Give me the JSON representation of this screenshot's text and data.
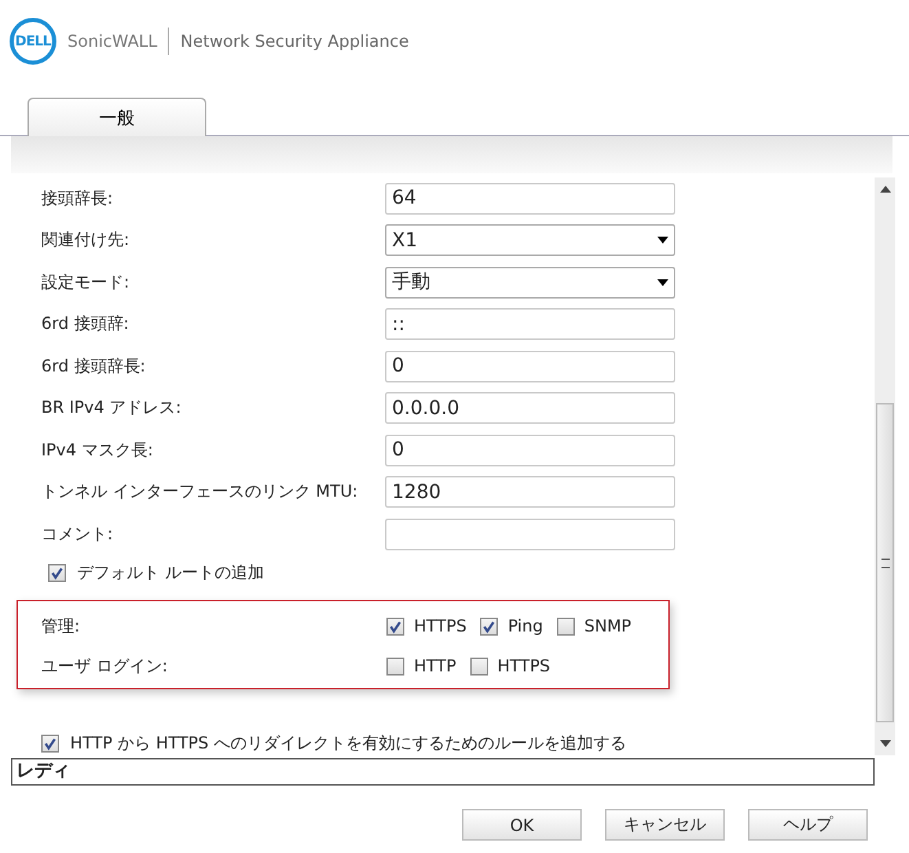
{
  "header": {
    "logo": "DELL",
    "product": "SonicWALL",
    "title": "Network Security Appliance"
  },
  "tabs": [
    {
      "label": "一般",
      "selected": true
    }
  ],
  "fields": [
    {
      "label": "接頭辞長:",
      "kind": "text",
      "value": "64"
    },
    {
      "label": "関連付け先:",
      "kind": "select",
      "value": "X1"
    },
    {
      "label": "設定モード:",
      "kind": "select",
      "value": "手動"
    },
    {
      "label": "6rd 接頭辞:",
      "kind": "text",
      "value": "::"
    },
    {
      "label": "6rd 接頭辞長:",
      "kind": "text",
      "value": "0"
    },
    {
      "label": "BR IPv4 アドレス:",
      "kind": "text",
      "value": "0.0.0.0"
    },
    {
      "label": "IPv4 マスク長:",
      "kind": "text",
      "value": "0"
    },
    {
      "label": "トンネル インターフェースのリンク MTU:",
      "kind": "text",
      "value": "1280"
    },
    {
      "label": "コメント:",
      "kind": "text"
    }
  ],
  "default_route": {
    "label": "デフォルト ルートの追加",
    "checked": true
  },
  "access": [
    {
      "label": "管理:",
      "options": [
        {
          "label": "HTTPS",
          "checked": true
        },
        {
          "label": "Ping",
          "checked": true
        },
        {
          "label": "SNMP",
          "checked": false
        }
      ]
    },
    {
      "label": "ユーザ ログイン:",
      "options": [
        {
          "label": "HTTP",
          "checked": false
        },
        {
          "label": "HTTPS",
          "checked": false
        }
      ]
    }
  ],
  "redirect": {
    "label": "HTTP から HTTPS へのリダイレクトを有効にするためのルールを追加する",
    "checked": true
  },
  "status_bar": "レディ",
  "buttons": [
    "OK",
    "キャンセル",
    "ヘルプ"
  ]
}
